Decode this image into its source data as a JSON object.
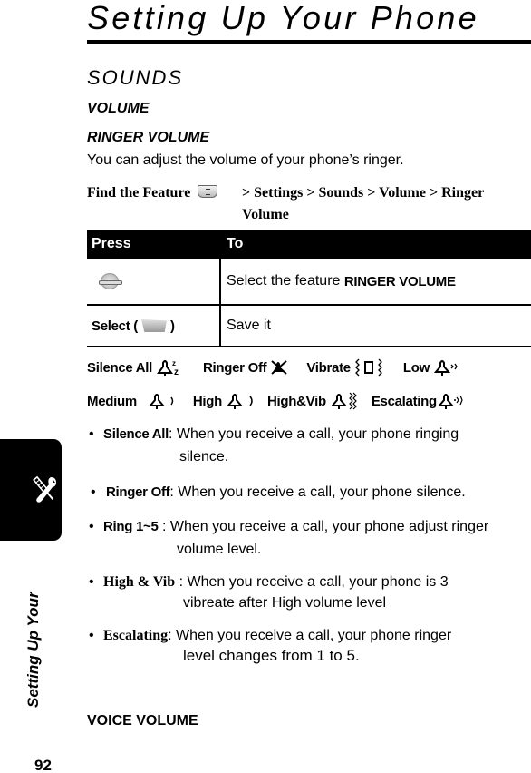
{
  "page": {
    "title": "Setting Up Your Phone",
    "page_number": "92",
    "side_tab_label": "Setting Up Your",
    "side_tab_icon": "tools-icon"
  },
  "section": "SOUNDS",
  "subsection": "VOLUME",
  "topic": {
    "title": "RINGER VOLUME",
    "intro": "You can adjust the volume of your phone’s ringer."
  },
  "find_feature": {
    "label": "Find the Feature",
    "icon": "menu-key-icon",
    "path": "> Settings > Sounds > Volume > Ringer Volume"
  },
  "table": {
    "headers": [
      "Press",
      "To"
    ],
    "rows": [
      {
        "press_icon": "nav-key-icon",
        "press_label": "",
        "to_text": "Select the feature ",
        "to_bold": "RINGER VOLUME"
      },
      {
        "press_icon": "soft-key-icon",
        "press_label": "Select (",
        "press_close": ")",
        "to_text": "Save it",
        "to_bold": ""
      }
    ]
  },
  "modes": [
    {
      "label": "Silence All",
      "icon": "silence-all-icon"
    },
    {
      "label": "Ringer Off",
      "icon": "ringer-off-icon"
    },
    {
      "label": "Vibrate",
      "icon": "vibrate-icon"
    },
    {
      "label": "Low",
      "icon": "ring-low-icon"
    },
    {
      "label": "Medium",
      "icon": "ring-medium-icon"
    },
    {
      "label": "High",
      "icon": "ring-high-icon"
    },
    {
      "label": "High&Vib",
      "icon": "ring-high-vib-icon"
    },
    {
      "label": "Escalating",
      "icon": "ring-escalating-icon"
    }
  ],
  "bullets": [
    {
      "term": "Silence All",
      "sep": ": ",
      "line1": "When you receive a call, your phone ringing",
      "line2": "silence."
    },
    {
      "term": "Ringer Off",
      "sep": ": ",
      "line1": "When you receive a call, your phone  silence.",
      "line2": ""
    },
    {
      "term": "Ring 1~5",
      "sep": " : ",
      "line1": "When you receive a call, your phone adjust ringer",
      "line2": "volume level."
    },
    {
      "term": "High & Vib",
      "sep": " : ",
      "line1": "When you receive a call, your phone is 3",
      "line2": "vibreate after High volume level"
    },
    {
      "term": "Escalating",
      "sep": ": ",
      "line1": "When you receive a call, your phone ringer",
      "line2": "level changes from 1 to 5."
    }
  ],
  "next_topic": "VOICE VOLUME"
}
